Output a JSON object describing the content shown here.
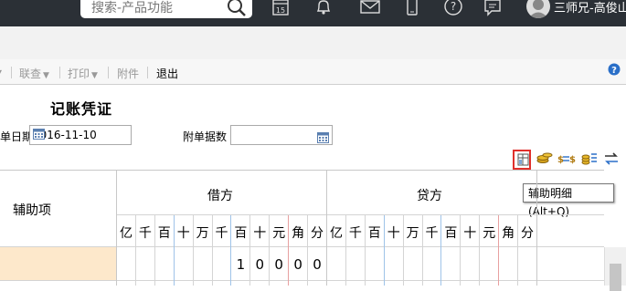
{
  "topbar": {
    "search_placeholder": "搜索-产品功能",
    "calendar_day": "15",
    "username": "三师兄-高俊山"
  },
  "toolbar": {
    "items": [
      {
        "label": "联查",
        "has_dropdown": true,
        "enabled": false
      },
      {
        "label": "打印",
        "has_dropdown": true,
        "enabled": false
      },
      {
        "label": "附件",
        "has_dropdown": false,
        "enabled": false
      },
      {
        "label": "退出",
        "has_dropdown": false,
        "enabled": true
      }
    ]
  },
  "voucher": {
    "title": "记账凭证",
    "date_label": "单日期",
    "date_value": "2016-11-10",
    "attachments_label": "附单据数",
    "attachments_value": ""
  },
  "voucher_tools": {
    "tooltip": "辅助明细(Alt+Q)",
    "icons": [
      "aux-detail-icon",
      "coins-icon",
      "currency-exchange-icon",
      "balance-icon",
      "swap-icon"
    ]
  },
  "table": {
    "aux_header": "辅助项",
    "debit_header": "借方",
    "credit_header": "贷方",
    "debit_units": [
      "亿",
      "千",
      "百",
      "十",
      "万",
      "千",
      "百",
      "十",
      "元",
      "角",
      "分"
    ],
    "credit_units": [
      "亿",
      "千",
      "百",
      "十",
      "万",
      "千",
      "百",
      "十",
      "元",
      "角",
      "分"
    ],
    "row1_debit_digits": [
      "",
      "",
      "",
      "",
      "",
      "",
      "1",
      "0",
      "0",
      "0",
      "0"
    ]
  },
  "colors": {
    "topbar": "#2b3036",
    "selected_row": "#fde8cb",
    "highlight_box": "#e0302c"
  }
}
